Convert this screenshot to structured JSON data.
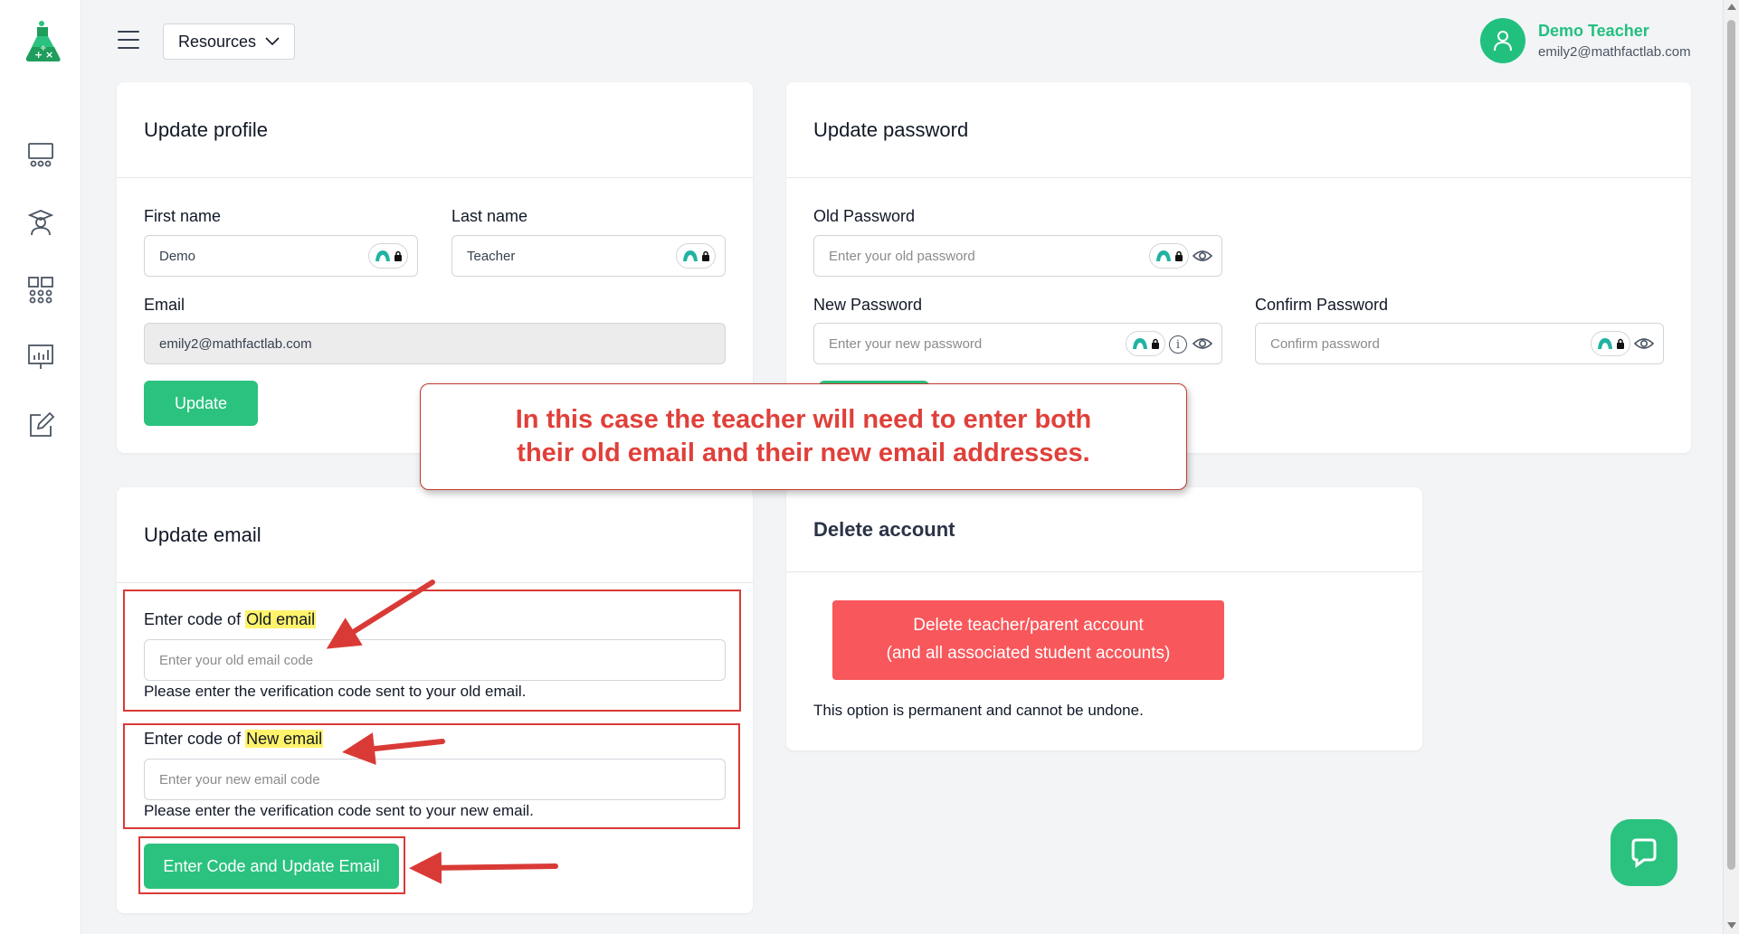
{
  "header": {
    "resources_label": "Resources",
    "user_name": "Demo Teacher",
    "user_email": "emily2@mathfactlab.com"
  },
  "profile": {
    "title": "Update profile",
    "first_name_label": "First name",
    "first_name_value": "Demo",
    "last_name_label": "Last name",
    "last_name_value": "Teacher",
    "email_label": "Email",
    "email_value": "emily2@mathfactlab.com",
    "update_button": "Update"
  },
  "password": {
    "title": "Update password",
    "old_label": "Old Password",
    "old_placeholder": "Enter your old password",
    "new_label": "New Password",
    "new_placeholder": "Enter your new password",
    "confirm_label": "Confirm Password",
    "confirm_placeholder": "Confirm password",
    "info_glyph": "i"
  },
  "email": {
    "title": "Update email",
    "old_code_label_prefix": "Enter code of ",
    "old_code_label_highlight": "Old email",
    "old_code_placeholder": "Enter your old email code",
    "old_code_help": "Please enter the verification code sent to your old email.",
    "new_code_label_prefix": "Enter code of ",
    "new_code_label_highlight": "New email",
    "new_code_placeholder": "Enter your new email code",
    "new_code_help": "Please enter the verification code sent to your new email.",
    "submit_button": "Enter Code and Update Email"
  },
  "delete": {
    "title": "Delete account",
    "button_line1": "Delete teacher/parent account",
    "button_line2": "(and all associated student accounts)",
    "note": "This option is permanent and cannot be undone."
  },
  "annotation": {
    "callout_line1": "In this case the teacher will need to enter both",
    "callout_line2": "their old email and their new email addresses."
  },
  "colors": {
    "brand_green": "#2bc27f",
    "danger_red": "#f8575b",
    "annotation_red": "#d93a36",
    "highlight_yellow": "#fff36b"
  }
}
